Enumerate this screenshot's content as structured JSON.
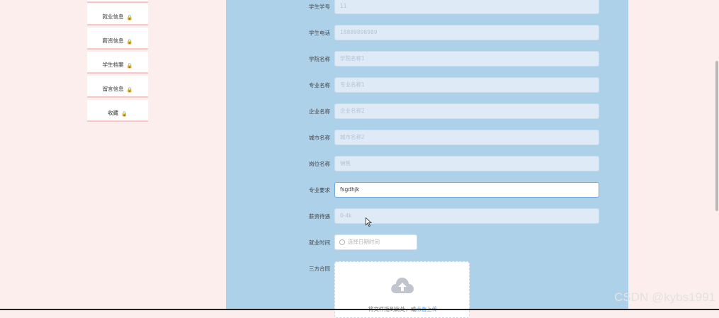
{
  "sidebar": {
    "items": [
      {
        "label": "",
        "icon": "lock-icon"
      },
      {
        "label": "就业信息",
        "icon": "lock-icon"
      },
      {
        "label": "薪资信息",
        "icon": "lock-icon"
      },
      {
        "label": "学生档案",
        "icon": "lock-icon"
      },
      {
        "label": "留言信息",
        "icon": "lock-icon"
      },
      {
        "label": "收藏",
        "icon": "lock-icon"
      }
    ]
  },
  "form": {
    "student_id": {
      "label": "学生学号",
      "value": "11"
    },
    "student_phone": {
      "label": "学生电话",
      "value": "18889898989"
    },
    "college_name": {
      "label": "学院名称",
      "value": "学院名称1"
    },
    "major_name": {
      "label": "专业名称",
      "value": "专业名称1"
    },
    "company_name": {
      "label": "企业名称",
      "value": "企业名称2"
    },
    "city_name": {
      "label": "城市名称",
      "value": "城市名称2"
    },
    "position_name": {
      "label": "岗位名称",
      "value": "销售"
    },
    "major_requirement": {
      "label": "专业要求",
      "value": "fsgdhjk"
    },
    "salary": {
      "label": "薪资待遇",
      "value": "0-4k"
    },
    "employment_time": {
      "label": "就业时间",
      "placeholder": "选择日期时间"
    },
    "contract": {
      "label": "三方合同",
      "upload_text": "将文件拖到此处，或",
      "upload_link": "点击上传"
    }
  },
  "watermark": "CSDN @kybs1991",
  "colors": {
    "page_bg": "#fdeeee",
    "panel_bg": "#aed1ea",
    "field_bg": "#deeaf5",
    "link": "#409eff"
  }
}
